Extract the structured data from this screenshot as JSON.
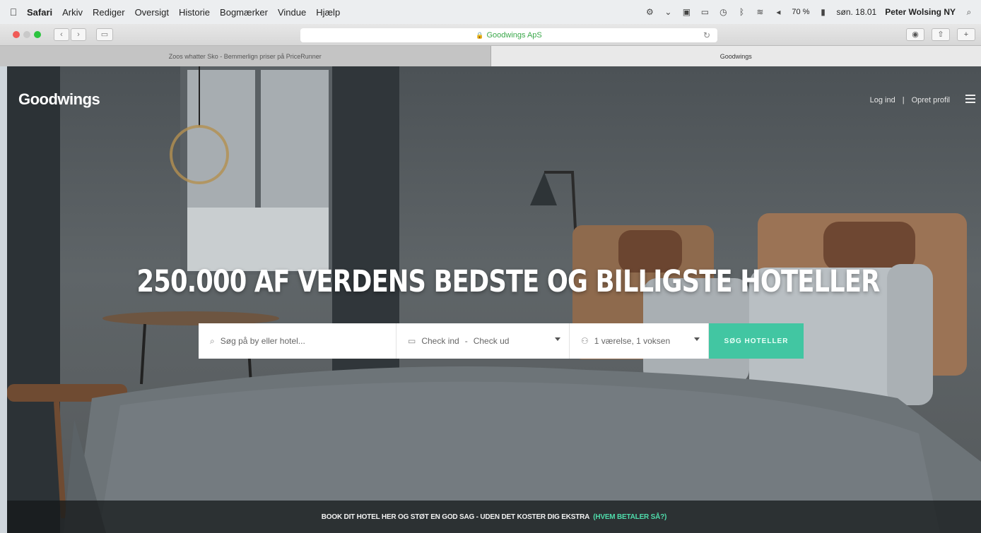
{
  "menubar": {
    "items": [
      "Safari",
      "Arkiv",
      "Rediger",
      "Oversigt",
      "Historie",
      "Bogmærker",
      "Vindue",
      "Hjælp"
    ],
    "battery": "70 %",
    "clock": "søn. 18.01",
    "user": "Peter Wolsing NY"
  },
  "browser": {
    "url": "Goodwings ApS",
    "tabs": [
      {
        "title": "Zoos whatter Sko - Bemmerlign priser på PriceRunner"
      },
      {
        "title": "Goodwings"
      }
    ]
  },
  "site": {
    "logo": "Goodwings",
    "login": "Log ind",
    "divider": "|",
    "signup": "Opret profil",
    "headline": "250.000 AF VERDENS BEDSTE OG BILLIGSTE HOTELLER",
    "search": {
      "placeholder": "Søg på by eller hotel...",
      "checkin": "Check ind",
      "dash": "-",
      "checkout": "Check ud",
      "guests": "1 værelse, 1 voksen",
      "button": "SØG HOTELLER"
    },
    "footer": {
      "text": "BOOK DIT HOTEL HER OG STØT EN GOD SAG - UDEN DET KOSTER DIG EKSTRA",
      "link": "(HVEM BETALER SÅ?)"
    }
  },
  "colors": {
    "accent": "#42c6a2",
    "footer_link": "#4fdcab"
  }
}
